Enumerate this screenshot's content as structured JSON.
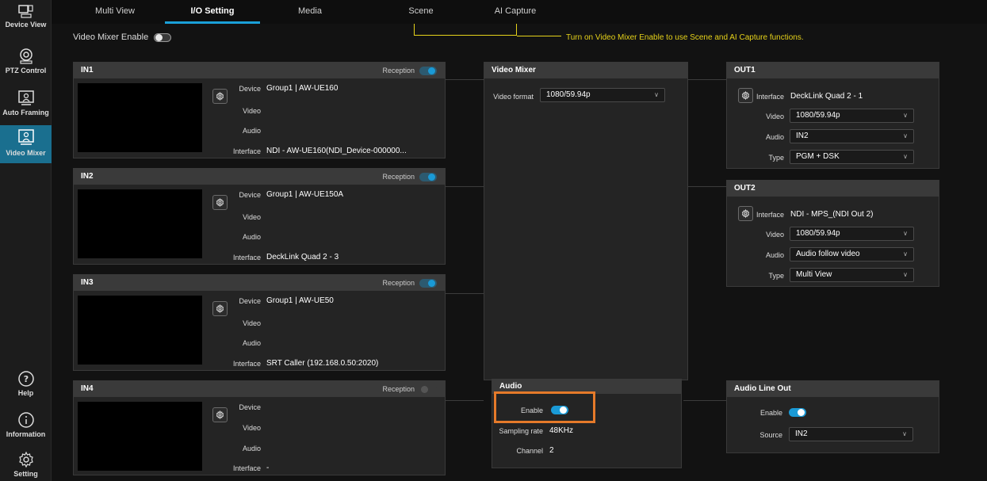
{
  "rail": {
    "device_view": "Device View",
    "ptz_control": "PTZ Control",
    "auto_framing": "Auto Framing",
    "video_mixer": "Video Mixer",
    "help": "Help",
    "information": "Information",
    "setting": "Setting"
  },
  "tabs": [
    "Multi View",
    "I/O Setting",
    "Media",
    "Scene",
    "AI Capture"
  ],
  "header": {
    "mixer_enable_label": "Video Mixer Enable",
    "hint": "Turn on Video Mixer Enable to use Scene and AI Capture functions."
  },
  "labels": {
    "reception": "Reception",
    "device": "Device",
    "video": "Video",
    "audio": "Audio",
    "interface": "Interface",
    "type": "Type",
    "video_format": "Video format",
    "enable": "Enable",
    "sampling_rate": "Sampling rate",
    "channel": "Channel",
    "source": "Source"
  },
  "inputs": [
    {
      "title": "IN1",
      "device": "Group1 | AW-UE160",
      "interface": "NDI - AW-UE160(NDI_Device-000000..."
    },
    {
      "title": "IN2",
      "device": "Group1 | AW-UE150A",
      "interface": "DeckLink Quad 2 - 3"
    },
    {
      "title": "IN3",
      "device": "Group1 | AW-UE50",
      "interface": "SRT Caller (192.168.0.50:2020)"
    },
    {
      "title": "IN4",
      "device": "",
      "interface": "-"
    }
  ],
  "video_mixer": {
    "title": "Video Mixer",
    "video_format": "1080/59.94p"
  },
  "audio": {
    "title": "Audio",
    "sampling_rate": "48KHz",
    "channel": "2"
  },
  "outputs": [
    {
      "title": "OUT1",
      "interface": "DeckLink Quad 2 - 1",
      "video": "1080/59.94p",
      "audio": "IN2",
      "type": "PGM + DSK"
    },
    {
      "title": "OUT2",
      "interface": "NDI - MPS_(NDI Out 2)",
      "video": "1080/59.94p",
      "audio": "Audio follow video",
      "type": "Multi View"
    }
  ],
  "audio_line_out": {
    "title": "Audio Line Out",
    "source": "IN2"
  },
  "colors": {
    "accent": "#1a9ad6",
    "hint": "#e6d21a",
    "highlight": "#e57a2a"
  }
}
